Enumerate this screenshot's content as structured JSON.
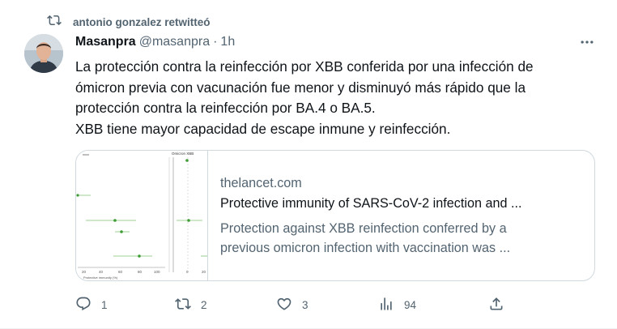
{
  "retweet": {
    "text": "antonio gonzalez retwitteó"
  },
  "author": {
    "name": "Masanpra",
    "handle": "@masanpra",
    "separator": "·",
    "time": "1h"
  },
  "tweet": {
    "lines": [
      "La protección contra la reinfección por XBB conferida por una infección de",
      "ómicron previa con vacunación fue menor y disminuyó más rápido que la",
      "protección contra la reinfección por BA.4 o BA.5.",
      "XBB tiene mayor capacidad de escape inmune y reinfección."
    ]
  },
  "card": {
    "domain": "thelancet.com",
    "title": "Protective immunity of SARS-CoV-2 infection and ...",
    "desc_lines": [
      "Protection against XBB reinfection conferred by a",
      "previous omicron infection with vaccination was ..."
    ],
    "thumb": {
      "panel_title": "Omicron XBB",
      "x_ticks_left": [
        "20",
        "40",
        "60",
        "80",
        "100"
      ],
      "x_ticks_right": [
        "0",
        "20"
      ],
      "x_label": "Protective immunity (%)",
      "accent": "#3e9c35"
    }
  },
  "actions": {
    "reply_count": "1",
    "retweet_count": "2",
    "like_count": "3",
    "views_count": "94"
  },
  "colors": {
    "text": "#0f1419",
    "secondary": "#536471",
    "border": "#cfd9de"
  }
}
